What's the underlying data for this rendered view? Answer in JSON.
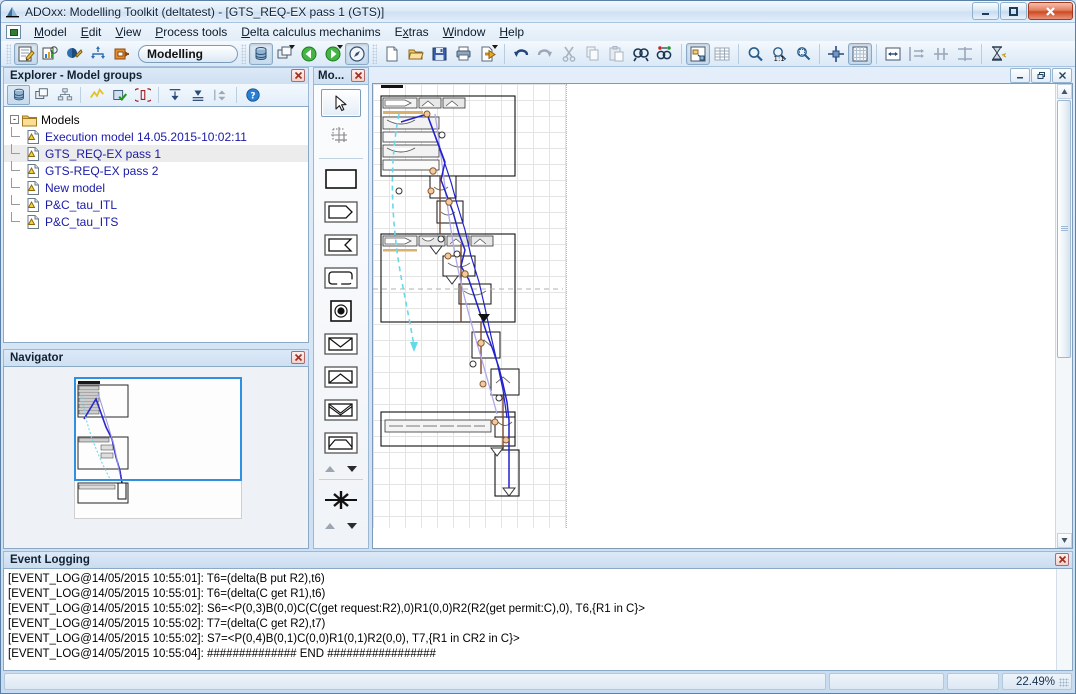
{
  "window": {
    "title": "ADOxx: Modelling Toolkit (deltatest) - [GTS_REQ-EX pass 1 (GTS)]",
    "app_icon": "adoxx-icon",
    "controls": {
      "minimize": "minimize-icon",
      "maximize": "maximize-icon",
      "close": "close-icon"
    },
    "mdi_controls": {
      "minimize": "mdi-minimize-icon",
      "restore": "mdi-restore-icon",
      "close": "mdi-close-icon"
    }
  },
  "menubar": {
    "system_icon": "window-menu-icon",
    "items": [
      {
        "label": "Model",
        "mnemonic": "M"
      },
      {
        "label": "Edit",
        "mnemonic": "E"
      },
      {
        "label": "View",
        "mnemonic": "V"
      },
      {
        "label": "Process tools",
        "mnemonic": "P"
      },
      {
        "label": "Delta calculus mechanims",
        "mnemonic": "D"
      },
      {
        "label": "Extras",
        "mnemonic": "x"
      },
      {
        "label": "Window",
        "mnemonic": "W"
      },
      {
        "label": "Help",
        "mnemonic": "H"
      }
    ]
  },
  "toolbar": {
    "mode_combo": "Modelling",
    "groups": [
      [
        "acquisition-icon",
        "analysis-icon",
        "simulation-icon",
        "evaluation-icon",
        "import-export-icon"
      ],
      [
        "database-icon",
        "model-windows-icon",
        "navigate-back-icon",
        "navigate-forward-icon",
        "browse-icon"
      ],
      [
        "new-icon",
        "open-icon",
        "save-icon",
        "print-icon",
        "export-icon"
      ],
      [
        "undo-icon",
        "redo-icon",
        "cut-icon",
        "copy-icon",
        "paste-icon",
        "find-icon",
        "find-replace-icon"
      ],
      [
        "model-view-icon",
        "table-view-icon"
      ],
      [
        "zoom-icon",
        "zoom-100-icon",
        "zoom-area-icon"
      ],
      [
        "center-icon",
        "grid-icon"
      ],
      [
        "resize-icon",
        "align-horizontal-icon",
        "align-vertical-icon",
        "distribute-icon"
      ],
      [
        "timer-icon"
      ]
    ]
  },
  "explorer": {
    "title": "Explorer - Model groups",
    "close_icon": "close-icon",
    "toolbar_icons": [
      "database-icon",
      "model-windows-icon",
      "model-groups-icon",
      "dynamic-icon",
      "validate-icon",
      "version-icon",
      "expand-all-icon",
      "collapse-all-icon",
      "expand-level-icon",
      "help-icon"
    ],
    "tree": {
      "root": {
        "label": "Models",
        "icon": "folder-icon",
        "expander": "-"
      },
      "items": [
        {
          "label": "Execution model 14.05.2015-10:02:11",
          "icon": "model-icon",
          "selected": false
        },
        {
          "label": "GTS_REQ-EX pass 1",
          "icon": "model-icon",
          "selected": true
        },
        {
          "label": "GTS-REQ-EX pass 2",
          "icon": "model-icon",
          "selected": false
        },
        {
          "label": "New model",
          "icon": "model-icon",
          "selected": false
        },
        {
          "label": "P&C_tau_ITL",
          "icon": "model-icon",
          "selected": false
        },
        {
          "label": "P&C_tau_ITS",
          "icon": "model-icon",
          "selected": false
        }
      ]
    }
  },
  "navigator": {
    "title": "Navigator",
    "close_icon": "close-icon",
    "viewport_color": "#2f8fe0"
  },
  "palette": {
    "title": "Mo...",
    "close_icon": "close-icon",
    "items": [
      {
        "name": "pointer-tool",
        "icon": "cursor-icon",
        "selected": true
      },
      {
        "name": "grid-tool",
        "icon": "grid-snap-icon",
        "selected": false
      },
      {
        "name": "rectangle-shape",
        "icon": "rectangle-icon",
        "selected": false
      },
      {
        "name": "pentagon-shape",
        "icon": "pentagon-icon",
        "selected": false
      },
      {
        "name": "chevron-shape",
        "icon": "chevron-box-icon",
        "selected": false
      },
      {
        "name": "rounded-shape",
        "icon": "rounded-box-icon",
        "selected": false
      },
      {
        "name": "node-shape",
        "icon": "filled-circle-icon",
        "selected": false
      },
      {
        "name": "envelope-down-shape",
        "icon": "envelope-down-icon",
        "selected": false
      },
      {
        "name": "envelope-up-shape",
        "icon": "envelope-up-icon",
        "selected": false
      },
      {
        "name": "envelope-double-shape",
        "icon": "envelope-double-icon",
        "selected": false
      },
      {
        "name": "envelope-flat-shape",
        "icon": "envelope-flat-icon",
        "selected": false
      }
    ],
    "connector": {
      "name": "connector-tool",
      "icon": "starburst-icon"
    },
    "scroll_up": "scroll-up-icon",
    "scroll_down": "scroll-down-icon"
  },
  "event_log": {
    "title": "Event Logging",
    "close_icon": "close-icon",
    "lines": [
      "[EVENT_LOG@14/05/2015 10:55:01]: T6=(delta(B put R2),t6)",
      "[EVENT_LOG@14/05/2015 10:55:01]: T6=(delta(C get R1),t6)",
      "[EVENT_LOG@14/05/2015 10:55:02]: S6=<P(0,3)B(0,0)C(C(get request:R2),0)R1(0,0)R2(R2(get permit:C),0), T6,{R1 in C}>",
      "[EVENT_LOG@14/05/2015 10:55:02]: T7=(delta(C get R2),t7)",
      "[EVENT_LOG@14/05/2015 10:55:02]: S7=<P(0,4)B(0,1)C(0,0)R1(0,1)R2(0,0), T7,{R1 in CR2 in C}>",
      "[EVENT_LOG@14/05/2015 10:55:04]: ############## END #################"
    ]
  },
  "statusbar": {
    "message": "",
    "field_b": "",
    "field_c": "",
    "zoom": "22.49%"
  },
  "canvas": {
    "zoom_percent": 22.49,
    "colors": {
      "edge_blue": "#2222cc",
      "edge_cyan": "#66d9e8",
      "edge_purple": "#b0a8e8",
      "edge_brown": "#7a4a30",
      "node_fill": "#f2c9a0",
      "shape_stroke": "#000000"
    }
  }
}
